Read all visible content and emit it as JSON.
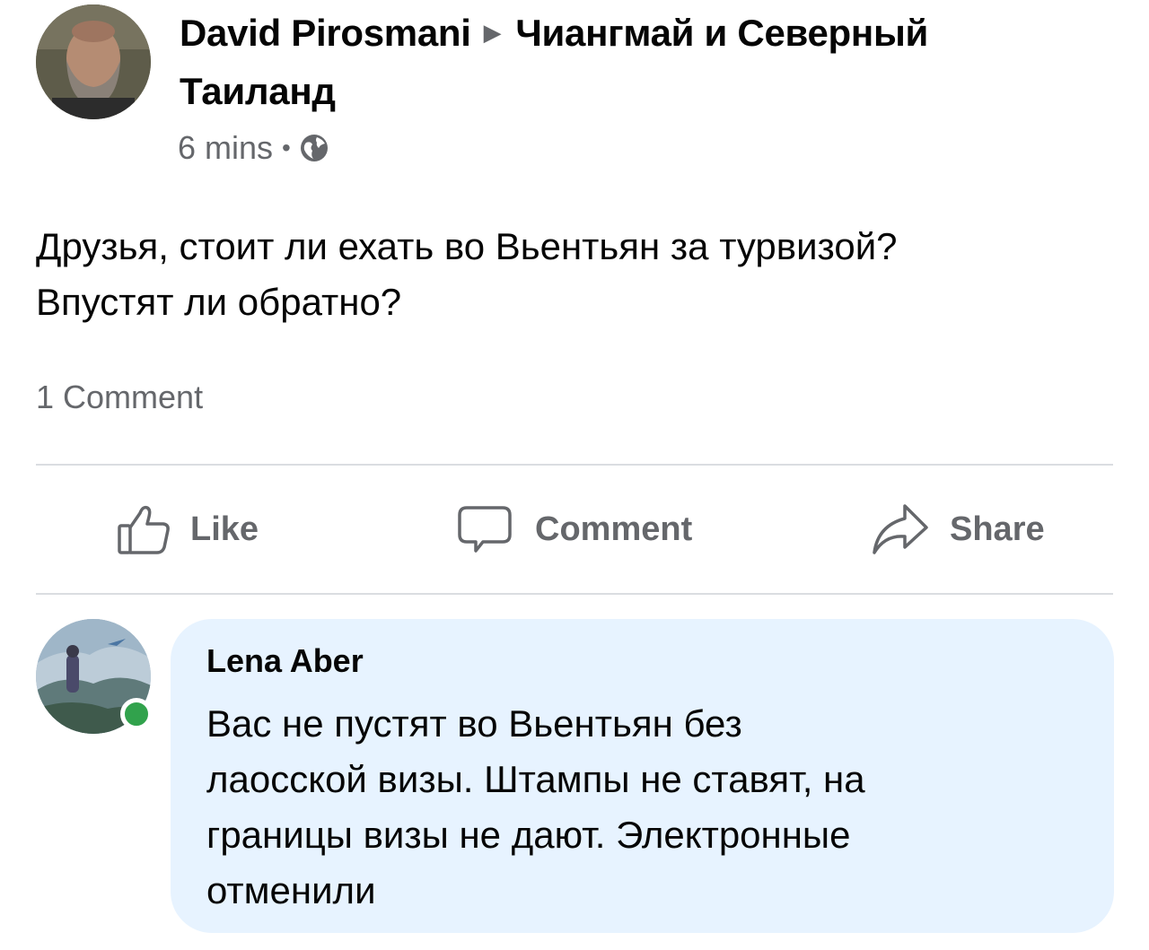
{
  "post": {
    "author": "David Pirosmani",
    "group_line1": "Чиангмай и Северный",
    "group_line2": "Таиланд",
    "time": "6 mins",
    "privacy_icon": "globe-icon",
    "text_line1": "Друзья, стоит ли ехать во Вьентьян за турвизой?",
    "text_line2": "Впустят ли обратно?",
    "comment_count": "1 Comment"
  },
  "actions": {
    "like": "Like",
    "comment": "Comment",
    "share": "Share"
  },
  "comment": {
    "author": "Lena Aber",
    "text_lines": [
      "Вас не пустят во Вьентьян без",
      "лаосской визы. Штампы не ставят, на",
      "границы визы не дают. Электронные",
      "отменили"
    ],
    "online": true
  },
  "colors": {
    "secondary_text": "#65676b",
    "bubble_bg": "#e7f3ff",
    "online": "#31a24c",
    "divider": "#dadde1"
  }
}
